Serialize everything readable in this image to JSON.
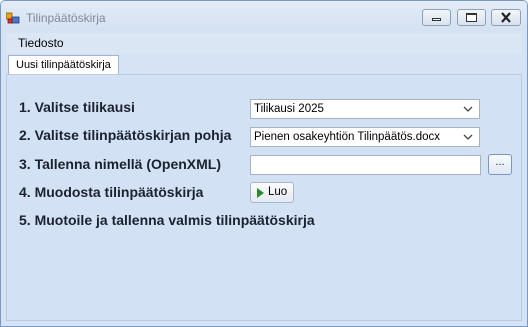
{
  "window": {
    "title": "Tilinpäätöskirja"
  },
  "menu": {
    "items": [
      {
        "label": "Tiedosto"
      }
    ]
  },
  "tabs": [
    {
      "label": "Uusi tilinpäätöskirja",
      "selected": true
    }
  ],
  "steps": {
    "step1": {
      "label": "1. Valitse tilikausi"
    },
    "step2": {
      "label": "2. Valitse tilinpäätöskirjan pohja"
    },
    "step3": {
      "label": "3. Tallenna nimellä (OpenXML)"
    },
    "step4": {
      "label": "4. Muodosta tilinpäätöskirja"
    },
    "step5": {
      "label": "5. Muotoile ja tallenna valmis tilinpäätöskirja"
    }
  },
  "fields": {
    "fiscal_period": {
      "selected": "Tilikausi 2025"
    },
    "template": {
      "selected": "Pienen osakeyhtiön Tilinpäätös.docx"
    },
    "save_as": {
      "value": "",
      "browse_label": "..."
    }
  },
  "actions": {
    "create_label": "Luo"
  },
  "icons": {
    "app": "app-icon",
    "minimize": "minimize-icon",
    "maximize": "maximize-icon",
    "close": "close-icon",
    "dropdown": "chevron-down-icon",
    "create": "play-icon"
  },
  "colors": {
    "accent": "#2a8a2a",
    "panel": "#d3e1f4",
    "titlebar": "#d4e1f2"
  }
}
